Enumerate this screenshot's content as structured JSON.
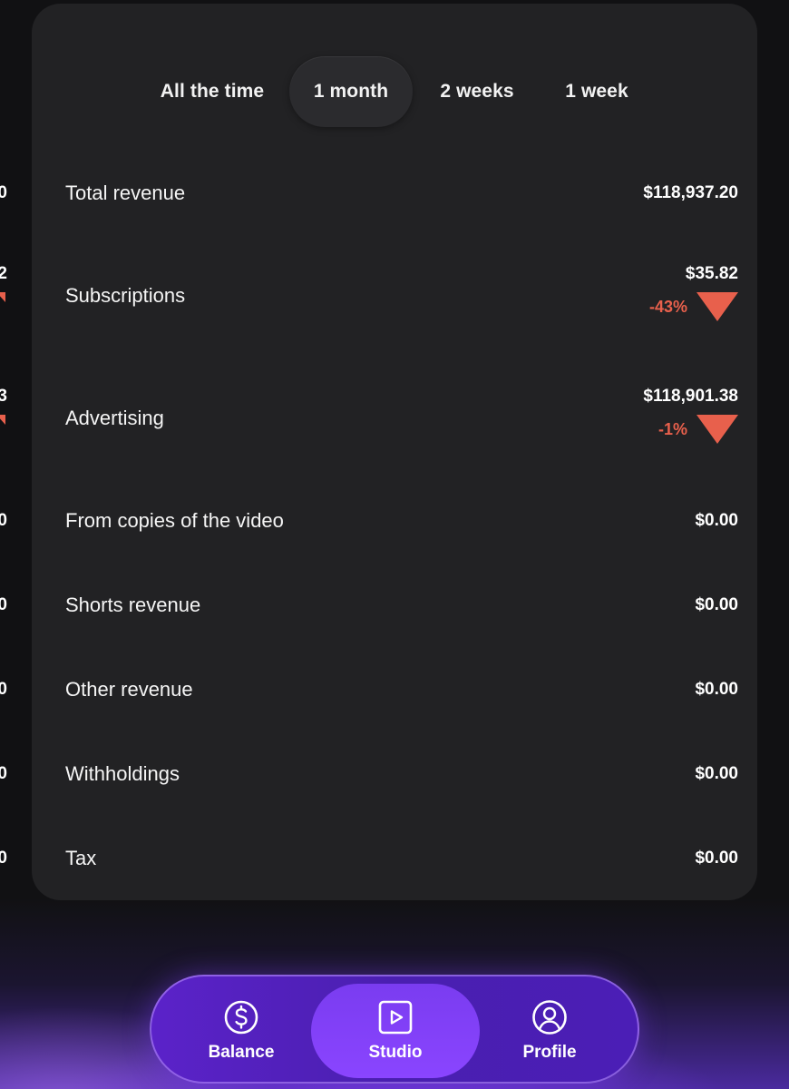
{
  "tabs": [
    {
      "label": "All the time",
      "active": false
    },
    {
      "label": "1 month",
      "active": true
    },
    {
      "label": "2 weeks",
      "active": false
    },
    {
      "label": "1 week",
      "active": false
    }
  ],
  "rows": [
    {
      "label": "Total revenue",
      "value": "$118,937.20"
    },
    {
      "label": "Subscriptions",
      "value": "$35.82",
      "change": "-43%",
      "trend": "down"
    },
    {
      "label": "Advertising",
      "value": "$118,901.38",
      "change": "-1%",
      "trend": "down"
    },
    {
      "label": "From copies of the video",
      "value": "$0.00"
    },
    {
      "label": "Shorts revenue",
      "value": "$0.00"
    },
    {
      "label": "Other revenue",
      "value": "$0.00"
    },
    {
      "label": "Withholdings",
      "value": "$0.00"
    },
    {
      "label": "Tax",
      "value": "$0.00"
    }
  ],
  "left_peek": [
    "0",
    "2",
    "3",
    "0",
    "0",
    "0",
    "0",
    "0"
  ],
  "nav": [
    {
      "label": "Balance",
      "icon": "dollar-circle-icon",
      "active": false
    },
    {
      "label": "Studio",
      "icon": "play-square-icon",
      "active": true
    },
    {
      "label": "Profile",
      "icon": "user-circle-icon",
      "active": false
    }
  ],
  "colors": {
    "negative": "#e8604c",
    "card": "#222224",
    "accent": "#7c3aed"
  }
}
